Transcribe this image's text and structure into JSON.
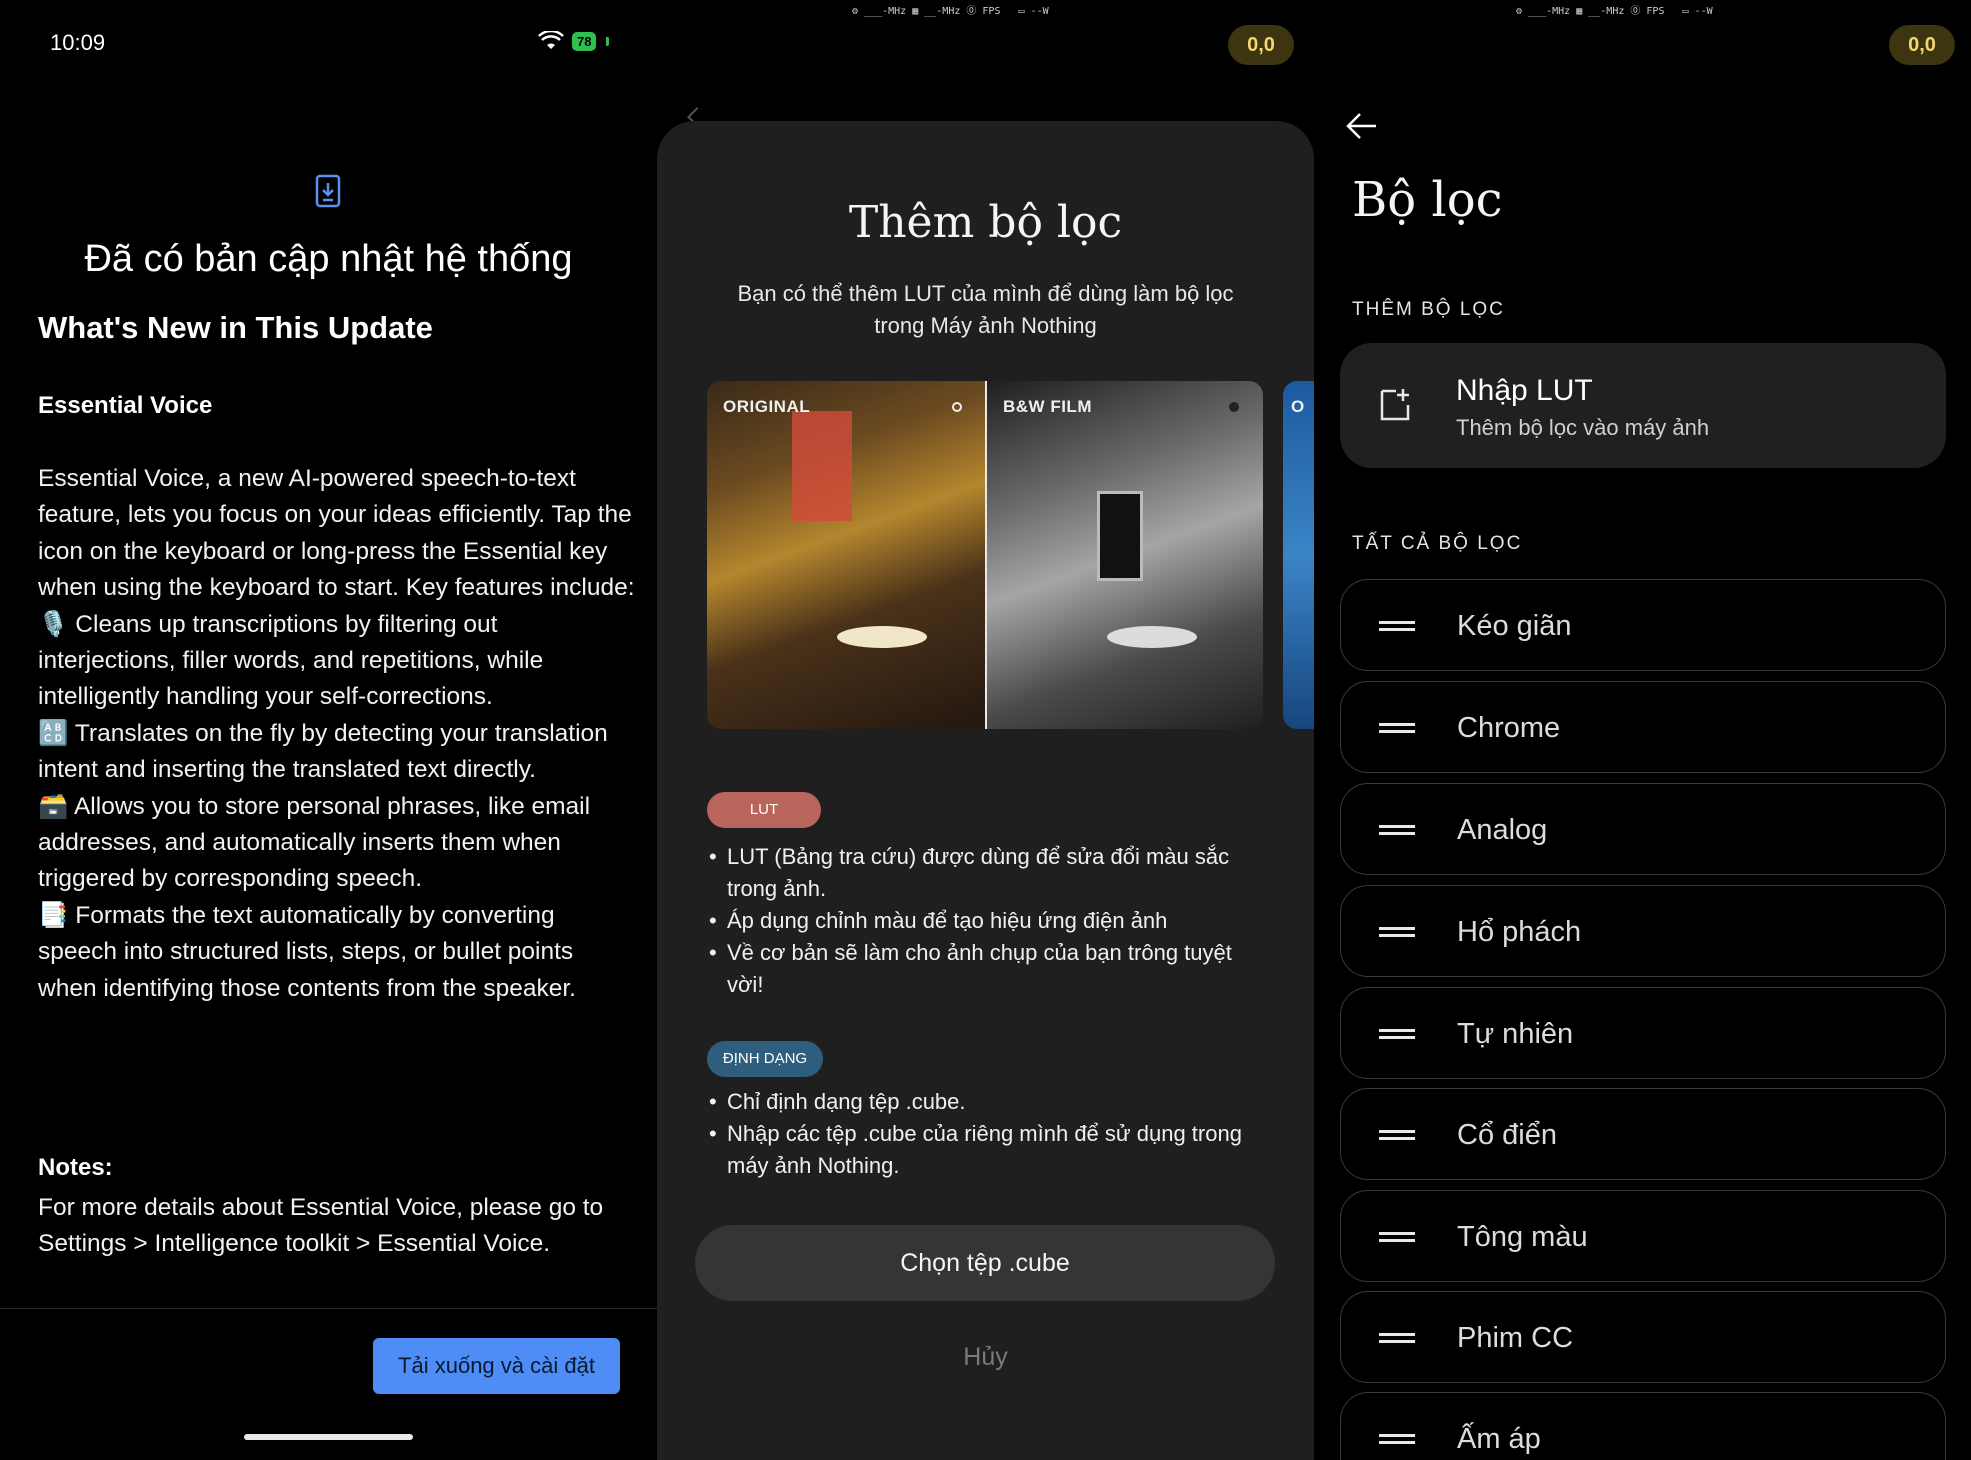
{
  "panel1": {
    "time": "10:09",
    "battery": "78",
    "title": "Đã có bản cập nhật hệ thống",
    "heading": "What's New in This Update",
    "feature_name": "Essential Voice",
    "intro": "Essential Voice, a new AI-powered speech-to-text feature, lets you focus on your ideas efficiently. Tap the icon on the keyboard or long-press the Essential key when using the keyboard to start. Key features include:",
    "bullets": [
      "🎙️ Cleans up transcriptions by filtering out interjections, filler words, and repetitions, while intelligently handling your self-corrections.",
      "🔠 Translates on the fly by detecting your translation intent and inserting the translated text directly.",
      "🗃️ Allows you to store personal phrases, like email addresses, and automatically inserts them when triggered by corresponding speech.",
      "📑 Formats the text automatically by converting speech into structured lists, steps, or bullet points when identifying those contents from the speaker."
    ],
    "notes_label": "Notes:",
    "notes_text": "For more details about Essential Voice, please go to Settings > Intelligence toolkit > Essential Voice.",
    "download_button": "Tải xuống và cài đặt"
  },
  "overlay": {
    "stats": "⚙ ___-MHz ▦ __-MHz ⓪ FPS   ▭ --W",
    "fps_value": "0,0"
  },
  "panel2": {
    "title": "Thêm bộ lọc",
    "subtitle": "Bạn có thể thêm LUT của mình để dùng làm bộ lọc trong Máy ảnh Nothing",
    "preview_left_label": "ORIGINAL",
    "preview_right_label": "B&W FILM",
    "preview_peek_label": "O",
    "chip_lut": "LUT",
    "lut_bullets": [
      "LUT (Bảng tra cứu) được dùng để sửa đổi màu sắc trong ảnh.",
      "Áp dụng chỉnh màu để tạo hiệu ứng điện ảnh",
      "Về cơ bản sẽ làm cho ảnh chụp của bạn trông tuyệt vời!"
    ],
    "chip_format": "ĐỊNH DẠNG",
    "format_bullets": [
      "Chỉ định dạng tệp .cube.",
      "Nhập các tệp .cube của riêng mình để sử dụng trong máy ảnh Nothing."
    ],
    "choose_button": "Chọn tệp .cube",
    "cancel": "Hủy"
  },
  "panel3": {
    "title": "Bộ lọc",
    "section_add": "THÊM BỘ LỌC",
    "import_title": "Nhập LUT",
    "import_sub": "Thêm bộ lọc vào máy ảnh",
    "section_all": "TẤT CẢ BỘ LỌC",
    "filters": [
      "Kéo giãn",
      "Chrome",
      "Analog",
      "Hổ phách",
      "Tự nhiên",
      "Cổ điển",
      "Tông màu",
      "Phim CC",
      "Ấm áp"
    ]
  },
  "colors": {
    "accent_blue": "#4d8df5",
    "lut_chip": "#b9655b",
    "format_chip": "#2f5d7e",
    "fps_badge": "#3d3410",
    "battery": "#2fbf4f"
  }
}
